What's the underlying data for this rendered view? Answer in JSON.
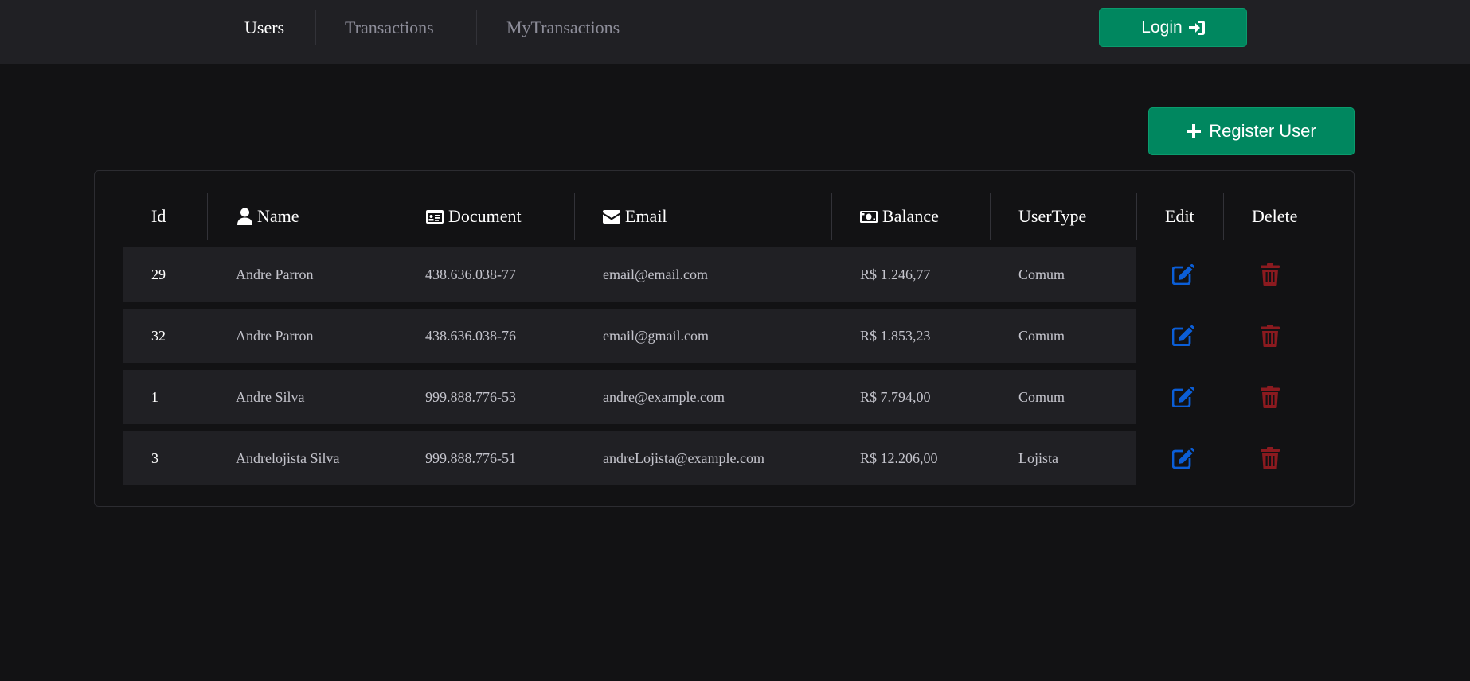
{
  "nav": {
    "items": [
      {
        "label": "Users",
        "active": true
      },
      {
        "label": "Transactions",
        "active": false
      },
      {
        "label": "MyTransactions",
        "active": false
      }
    ],
    "login_label": "Login",
    "login_icon": "sign-in-icon"
  },
  "actions": {
    "register_label": "Register User",
    "register_icon": "plus-icon"
  },
  "table": {
    "headers": {
      "id": "Id",
      "name": "Name",
      "document": "Document",
      "email": "Email",
      "balance": "Balance",
      "usertype": "UserType",
      "edit": "Edit",
      "delete": "Delete"
    },
    "header_icons": {
      "name": "user-icon",
      "document": "id-card-icon",
      "email": "envelope-icon",
      "balance": "money-bill-icon"
    },
    "rows": [
      {
        "id": "29",
        "name": "Andre Parron",
        "document": "438.636.038-77",
        "email": "email@email.com",
        "balance": "R$ 1.246,77",
        "usertype": "Comum"
      },
      {
        "id": "32",
        "name": "Andre Parron",
        "document": "438.636.038-76",
        "email": "email@gmail.com",
        "balance": "R$ 1.853,23",
        "usertype": "Comum"
      },
      {
        "id": "1",
        "name": "Andre Silva",
        "document": "999.888.776-53",
        "email": "andre@example.com",
        "balance": "R$ 7.794,00",
        "usertype": "Comum"
      },
      {
        "id": "3",
        "name": "Andrelojista Silva",
        "document": "999.888.776-51",
        "email": "andreLojista@example.com",
        "balance": "R$ 12.206,00",
        "usertype": "Lojista"
      }
    ]
  },
  "colors": {
    "background": "#121214",
    "header_bg": "#202024",
    "brand_green": "#00875f",
    "edit_blue": "#0b5ed7",
    "delete_red": "#8b1a1f"
  }
}
